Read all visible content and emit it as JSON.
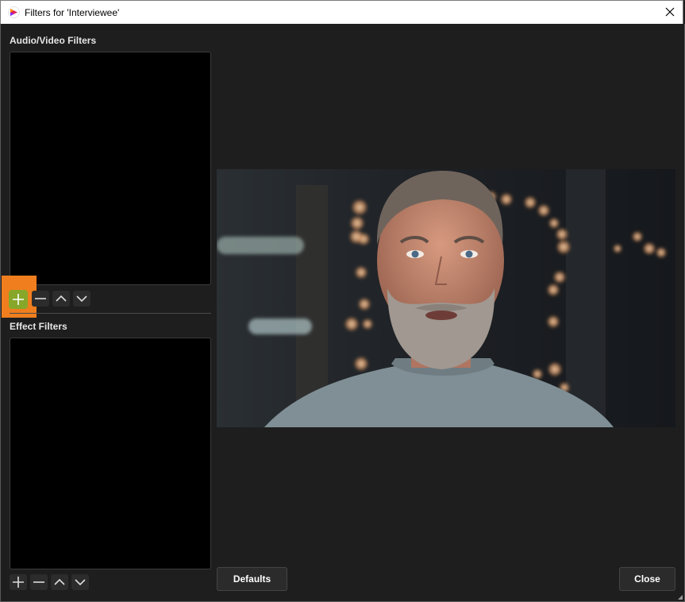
{
  "window": {
    "title": "Filters for 'Interviewee'"
  },
  "audio_video": {
    "label": "Audio/Video Filters",
    "items": []
  },
  "effect": {
    "label": "Effect Filters",
    "items": []
  },
  "buttons": {
    "defaults": "Defaults",
    "close": "Close"
  },
  "icons": {
    "app": "streaming-app-icon",
    "close": "close-icon",
    "add": "plus-icon",
    "remove": "minus-icon",
    "move_up": "chevron-up-icon",
    "move_down": "chevron-down-icon",
    "resize": "resize-grip-icon"
  },
  "colors": {
    "background": "#1e1e1e",
    "list_background": "#000000",
    "highlight": "#f07e1e",
    "add_active": "#86a72a"
  }
}
